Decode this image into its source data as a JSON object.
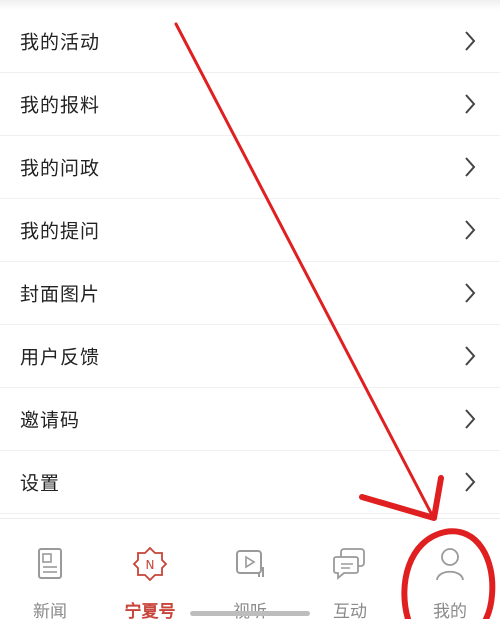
{
  "menu": {
    "items": [
      {
        "label": "我的活动"
      },
      {
        "label": "我的报料"
      },
      {
        "label": "我的问政"
      },
      {
        "label": "我的提问"
      },
      {
        "label": "封面图片"
      },
      {
        "label": "用户反馈"
      },
      {
        "label": "邀请码"
      },
      {
        "label": "设置"
      }
    ]
  },
  "tabbar": {
    "tabs": [
      {
        "label": "新闻",
        "icon": "news-icon"
      },
      {
        "label": "宁夏号",
        "icon": "ningxia-hao-icon",
        "active": true
      },
      {
        "label": "视听",
        "icon": "video-icon"
      },
      {
        "label": "互动",
        "icon": "chat-icon"
      },
      {
        "label": "我的",
        "icon": "user-icon"
      }
    ]
  },
  "colors": {
    "active_tab": "#c8443a",
    "inactive_tab": "#8a8a8a",
    "annotation": "#e02020"
  }
}
